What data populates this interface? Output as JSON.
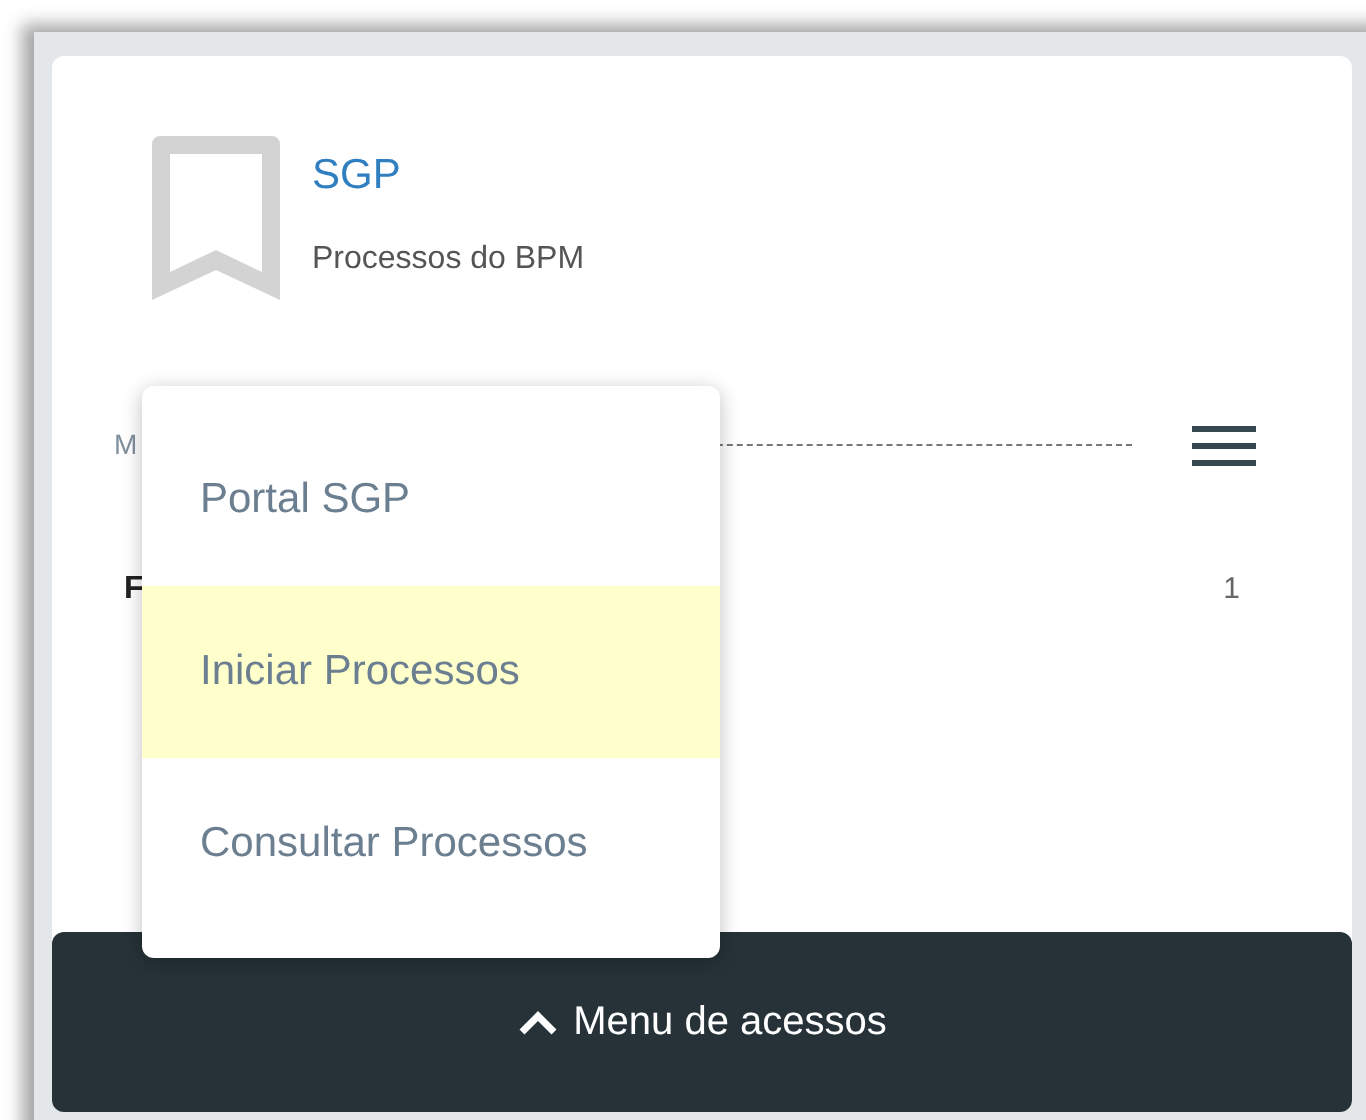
{
  "header": {
    "title": "SGP",
    "subtitle": "Processos do BPM"
  },
  "section": {
    "label": "M"
  },
  "row": {
    "label": "F",
    "count": "1"
  },
  "menu": {
    "items": [
      {
        "label": "Portal SGP",
        "selected": false
      },
      {
        "label": "Iniciar Processos",
        "selected": true
      },
      {
        "label": "Consultar Processos",
        "selected": false
      }
    ]
  },
  "footer": {
    "label": "Menu de acessos",
    "expanded": true
  }
}
